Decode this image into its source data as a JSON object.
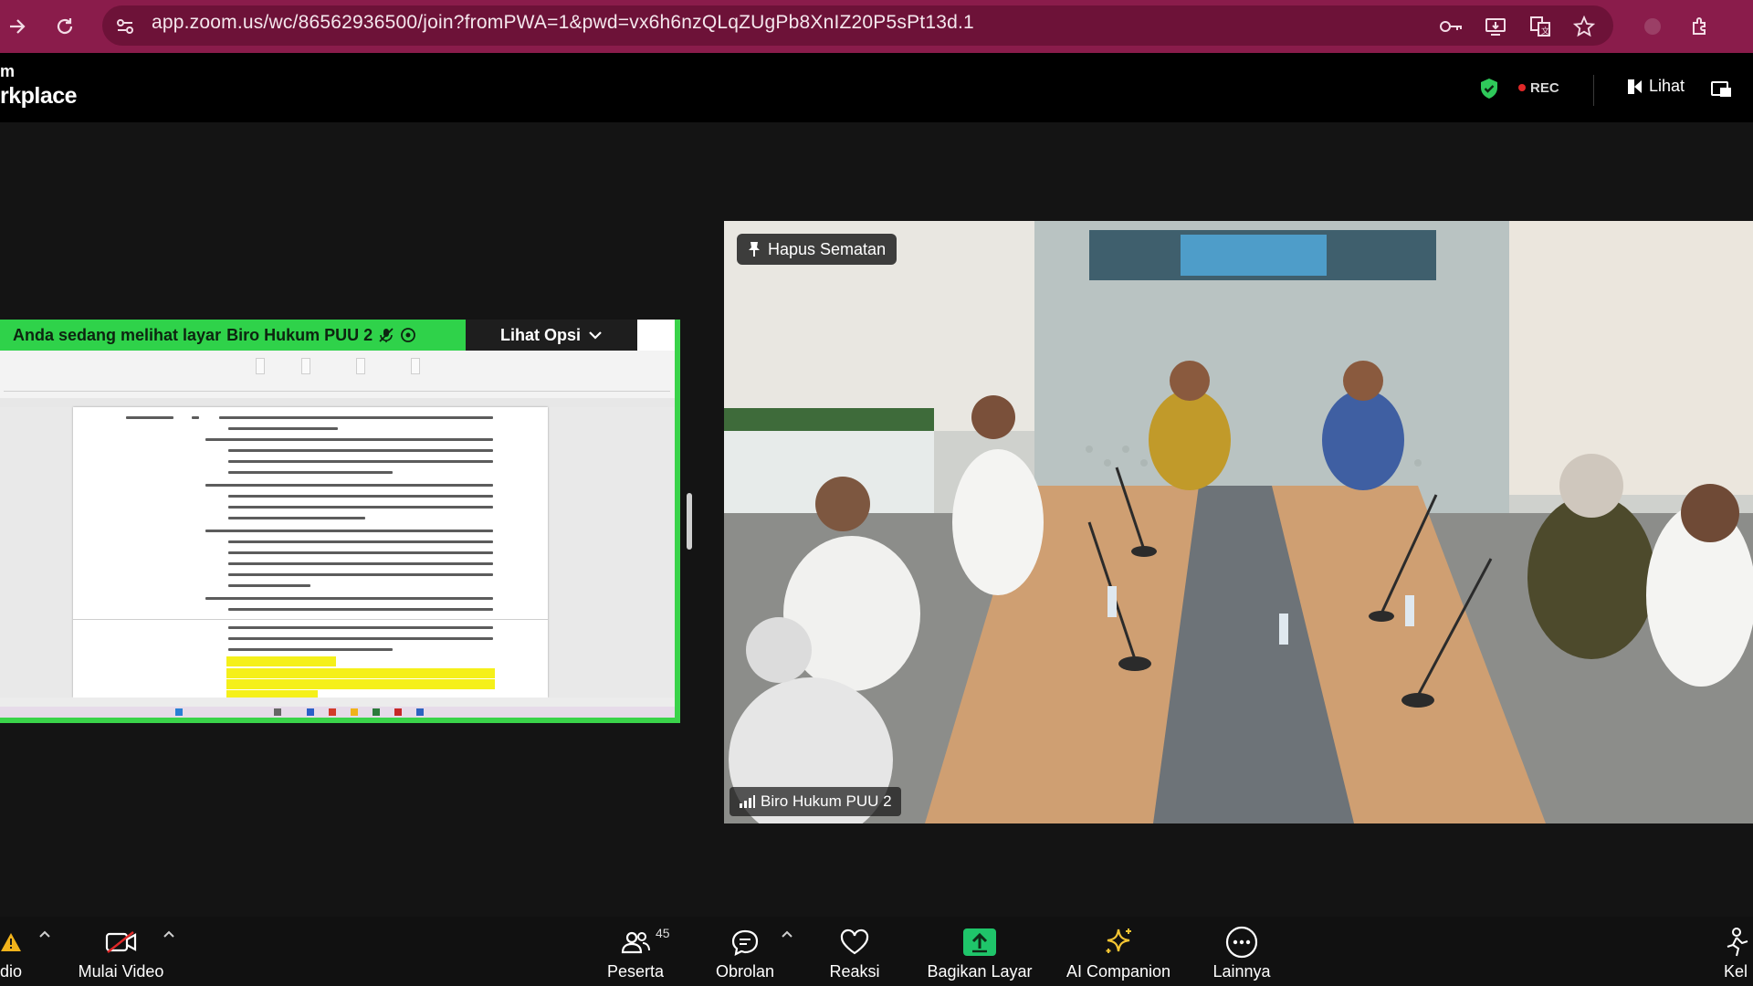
{
  "browser": {
    "url": "app.zoom.us/wc/86562936500/join?fromPWA=1&pwd=vx6h6nzQLqZUgPb8XnIZ20P5sPt13d.1",
    "icons": [
      "forward-icon",
      "reload-icon",
      "site-settings-icon",
      "password-key-icon",
      "install-app-icon",
      "translate-icon",
      "bookmark-star-icon",
      "extension-icon",
      "extensions-puzzle-icon"
    ],
    "accent": "#8a1c4b"
  },
  "header": {
    "brand_top": "m",
    "brand_bottom": "rkplace",
    "rec_label": "REC",
    "view_label": "Lihat"
  },
  "share": {
    "banner_text": "Anda sedang melihat layar",
    "presenter": "Biro Hukum PUU 2",
    "options_label": "Lihat Opsi",
    "highlight_color": "#2fd24a"
  },
  "video": {
    "pin_label": "Hapus Sematan",
    "participant_name": "Biro Hukum PUU 2"
  },
  "toolbar": {
    "audio_label": "dio",
    "video_label": "Mulai Video",
    "participants_label": "Peserta",
    "participants_count": "45",
    "chat_label": "Obrolan",
    "reactions_label": "Reaksi",
    "share_label": "Bagikan Layar",
    "ai_label": "AI Companion",
    "more_label": "Lainnya",
    "leave_label": "Kel"
  }
}
